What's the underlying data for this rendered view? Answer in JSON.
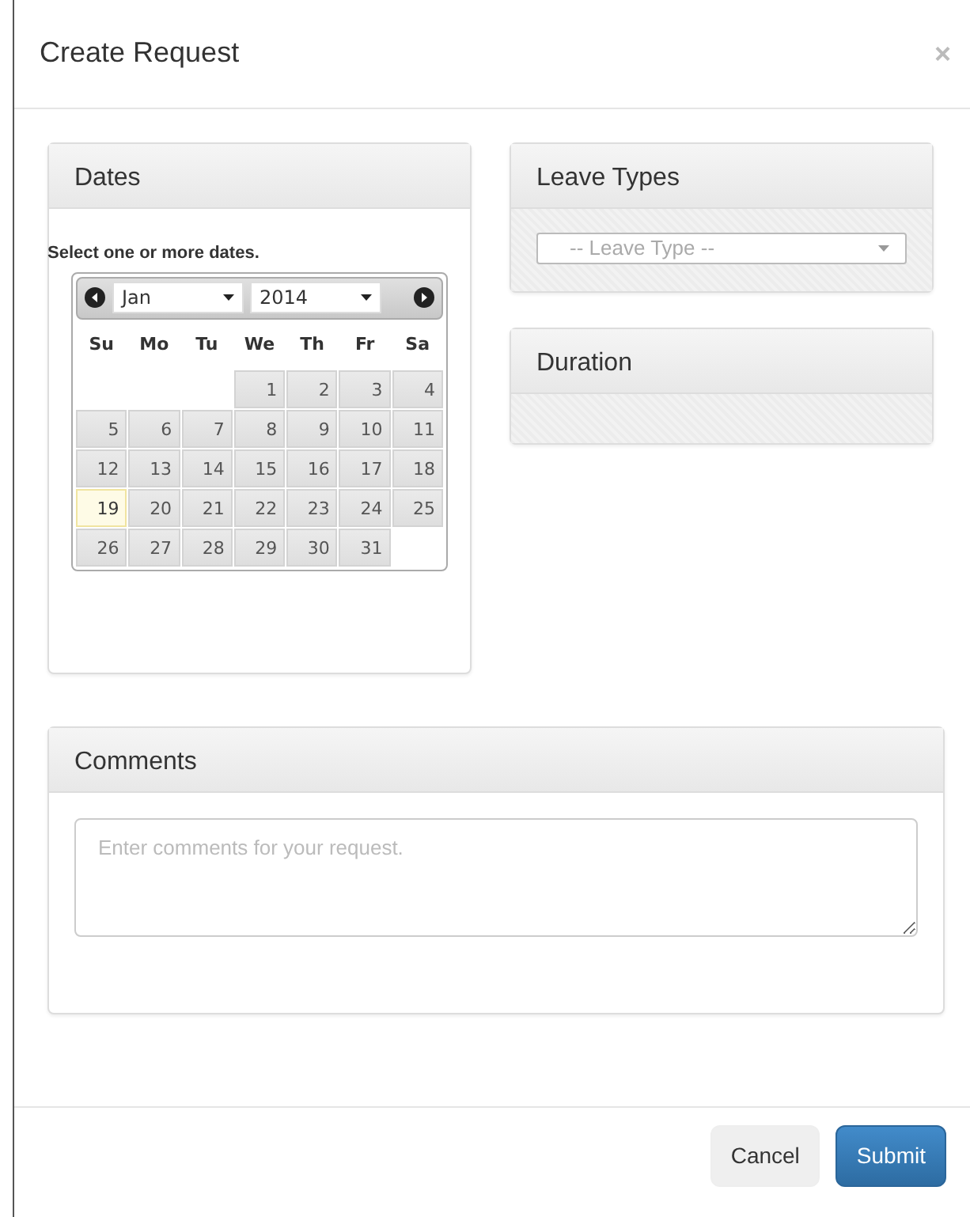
{
  "dialog": {
    "title": "Create Request",
    "close": "×"
  },
  "dates_panel": {
    "heading": "Dates",
    "hint": "Select one or more dates.",
    "calendar": {
      "month": "Jan",
      "year": "2014",
      "weekdays": [
        "Su",
        "Mo",
        "Tu",
        "We",
        "Th",
        "Fr",
        "Sa"
      ],
      "weeks": [
        [
          {
            "kind": "empty"
          },
          {
            "kind": "empty"
          },
          {
            "kind": "empty"
          },
          {
            "day": "1",
            "highlighted": false
          },
          {
            "day": "2",
            "highlighted": false
          },
          {
            "day": "3",
            "highlighted": false
          },
          {
            "day": "4",
            "highlighted": false
          }
        ],
        [
          {
            "day": "5",
            "highlighted": false
          },
          {
            "day": "6",
            "highlighted": false
          },
          {
            "day": "7",
            "highlighted": false
          },
          {
            "day": "8",
            "highlighted": false
          },
          {
            "day": "9",
            "highlighted": false
          },
          {
            "day": "10",
            "highlighted": false
          },
          {
            "day": "11",
            "highlighted": false
          }
        ],
        [
          {
            "day": "12",
            "highlighted": false
          },
          {
            "day": "13",
            "highlighted": false
          },
          {
            "day": "14",
            "highlighted": false
          },
          {
            "day": "15",
            "highlighted": false
          },
          {
            "day": "16",
            "highlighted": false
          },
          {
            "day": "17",
            "highlighted": false
          },
          {
            "day": "18",
            "highlighted": false
          }
        ],
        [
          {
            "day": "19",
            "highlighted": true
          },
          {
            "day": "20",
            "highlighted": false
          },
          {
            "day": "21",
            "highlighted": false
          },
          {
            "day": "22",
            "highlighted": false
          },
          {
            "day": "23",
            "highlighted": false
          },
          {
            "day": "24",
            "highlighted": false
          },
          {
            "day": "25",
            "highlighted": false
          }
        ],
        [
          {
            "day": "26",
            "highlighted": false
          },
          {
            "day": "27",
            "highlighted": false
          },
          {
            "day": "28",
            "highlighted": false
          },
          {
            "day": "29",
            "highlighted": false
          },
          {
            "day": "30",
            "highlighted": false
          },
          {
            "day": "31",
            "highlighted": false
          },
          {
            "kind": "empty"
          }
        ]
      ]
    }
  },
  "leave_types_panel": {
    "heading": "Leave Types",
    "select": {
      "placeholder": "-- Leave Type --"
    }
  },
  "duration_panel": {
    "heading": "Duration"
  },
  "comments_panel": {
    "heading": "Comments",
    "textarea": {
      "placeholder": "Enter comments for your request."
    }
  },
  "buttons": [
    {
      "label": "Cancel",
      "kind": "secondary"
    },
    {
      "label": "Submit",
      "kind": "primary"
    }
  ]
}
